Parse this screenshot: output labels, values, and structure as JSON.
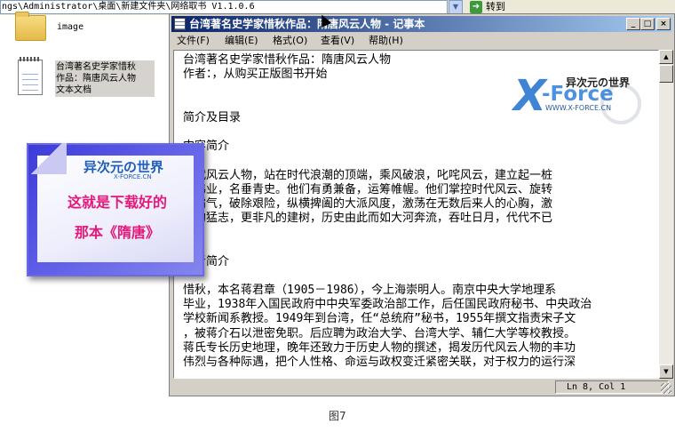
{
  "explorer": {
    "address": "ngs\\Administrator\\桌面\\新建文件夹\\网络取书 V1.1.0.6",
    "goto_label": "转到",
    "items": [
      {
        "label": "image"
      },
      {
        "label_lines": [
          "台湾著名史学家惜秋",
          "作品：隋唐风云人物",
          "文本文档"
        ]
      }
    ]
  },
  "callout": {
    "brand": "异次元の世界",
    "brand_sub": "X-FORCE.CN",
    "lines": [
      "这就是下载好的",
      "那本《隋唐》"
    ],
    "colors": {
      "accent": "#e6177a",
      "border": "#3b3bd8"
    }
  },
  "notepad": {
    "title": "台湾著名史学家惜秋作品：隋唐风云人物 - 记事本",
    "menus": [
      "文件(F)",
      "编辑(E)",
      "格式(O)",
      "查看(V)",
      "帮助(H)"
    ],
    "lines": [
      "台湾著名史学家惜秋作品：隋唐风云人物",
      "作者：，从购买正版图书开始",
      "",
      "",
      "简介及目录",
      "",
      "内容简介",
      "",
      "历代风云人物，站在时代浪潮的顶端，乘风破浪，叱咤风云，建立起一桩",
      "雄伟业，名垂青史。他们有勇兼备，运筹帷幄。他们掌控时代风云、旋转",
      "的霸气，破除艰险，纵横捭阖的大派风度，激荡在无数后来人的心胸，激",
      "大的猛志，更非凡的建树，历史由此而如大河奔流，吞吐日月，代代不已",
      "",
      "",
      "作者简介",
      "",
      "惜秋，本名蒋君章（1905－1986），今上海崇明人。南京中央大学地理系",
      "毕业，1938年入国民政府中中央军委政治部工作，后任国民政府秘书、中央政治",
      "学校新闻系教授。1949年到台湾，任“总统府”秘书，1955年撰文指责宋子文",
      "，被蒋介石以泄密免职。后应聘为政治大学、台湾大学、辅仁大学等校教授。",
      "蒋氏专长历史地理，晚年还致力于历史人物的撰述，揭发历代风云人物的丰功",
      "伟烈与各种际遇，把个人性格、命运与政权变迁紧密关联，对于权力的运行深"
    ],
    "status": "Ln 8, Col 1",
    "watermark": {
      "top": "异次元の世界",
      "x": "X",
      "force": "-Force",
      "url": "WWW.X-FORCE.CN",
      "tail": "N"
    }
  },
  "caption": "图7"
}
